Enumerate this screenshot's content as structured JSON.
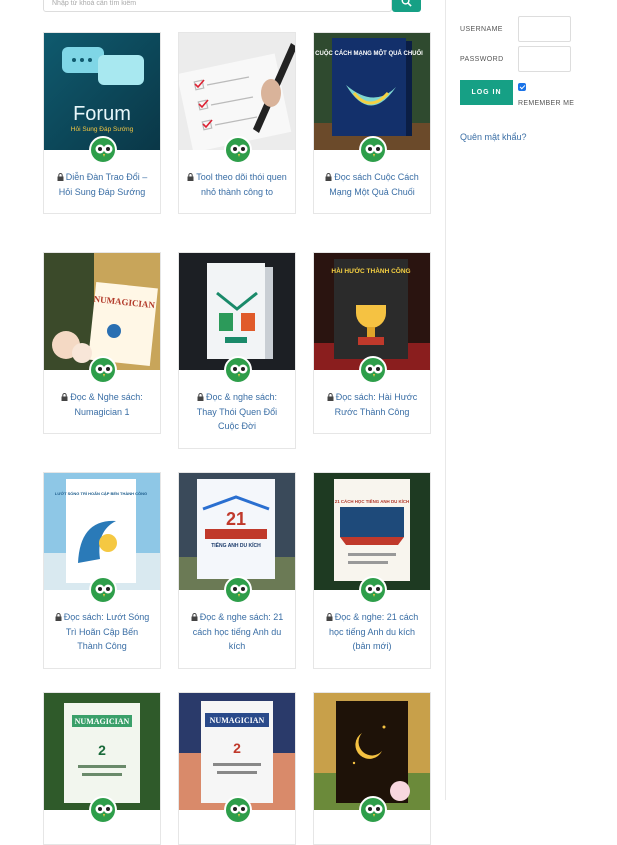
{
  "search": {
    "placeholder": "Nhập từ khoá cần tìm kiếm"
  },
  "login": {
    "username_label": "USERNAME",
    "password_label": "PASSWORD",
    "button_label": "LOG IN",
    "remember_label": "REMEMBER ME",
    "forgot_label": "Quên mật khẩu?"
  },
  "colors": {
    "accent": "#16a085",
    "link": "#3a6ea5",
    "badge": "#2e9e4a"
  },
  "cards": [
    {
      "title": "Diễn Đàn Trao Đổi – Hỏi Sung Đáp Sướng",
      "cover_text": "Forum",
      "cover_sub": "Hỏi Sung Đáp Sướng",
      "locked": true
    },
    {
      "title": "Tool theo dõi thói quen nhỏ thành công to",
      "cover_text": "",
      "cover_sub": "",
      "locked": true
    },
    {
      "title": "Đọc sách Cuộc Cách Mạng Một Quả Chuối",
      "cover_text": "CUỘC CÁCH MẠNG MỘT QUẢ CHUỐI",
      "cover_sub": "",
      "locked": true
    },
    {
      "title": "Đọc & Nghe sách: Numagician 1",
      "cover_text": "NUMAGICIAN",
      "cover_sub": "",
      "locked": true
    },
    {
      "title": "Đọc & nghe sách: Thay Thói Quen Đổi Cuộc Đời",
      "cover_text": "",
      "cover_sub": "",
      "locked": true
    },
    {
      "title": "Đọc sách: Hài Hước Rước Thành Công",
      "cover_text": "HÀI HƯỚC THÀNH CÔNG",
      "cover_sub": "",
      "locked": true
    },
    {
      "title": "Đọc sách: Lướt Sóng Trì Hoãn Cập Bến Thành Công",
      "cover_text": "LƯỚT SÓNG TRÌ HOÃN CẬP BẾN THÀNH CÔNG",
      "cover_sub": "",
      "locked": true
    },
    {
      "title": "Đọc & nghe sách: 21 cách học tiếng Anh du kích",
      "cover_text": "21",
      "cover_sub": "TIẾNG ANH DU KÍCH",
      "locked": true
    },
    {
      "title": "Đọc & nghe: 21 cách học tiếng Anh du kích (bản mới)",
      "cover_text": "21 CÁCH HỌC TIẾNG ANH DU KÍCH",
      "cover_sub": "",
      "locked": true
    },
    {
      "title": "",
      "cover_text": "NUMAGICIAN",
      "cover_sub": "",
      "locked": false
    },
    {
      "title": "",
      "cover_text": "NUMAGICIAN",
      "cover_sub": "",
      "locked": false
    },
    {
      "title": "",
      "cover_text": "",
      "cover_sub": "",
      "locked": false
    }
  ]
}
